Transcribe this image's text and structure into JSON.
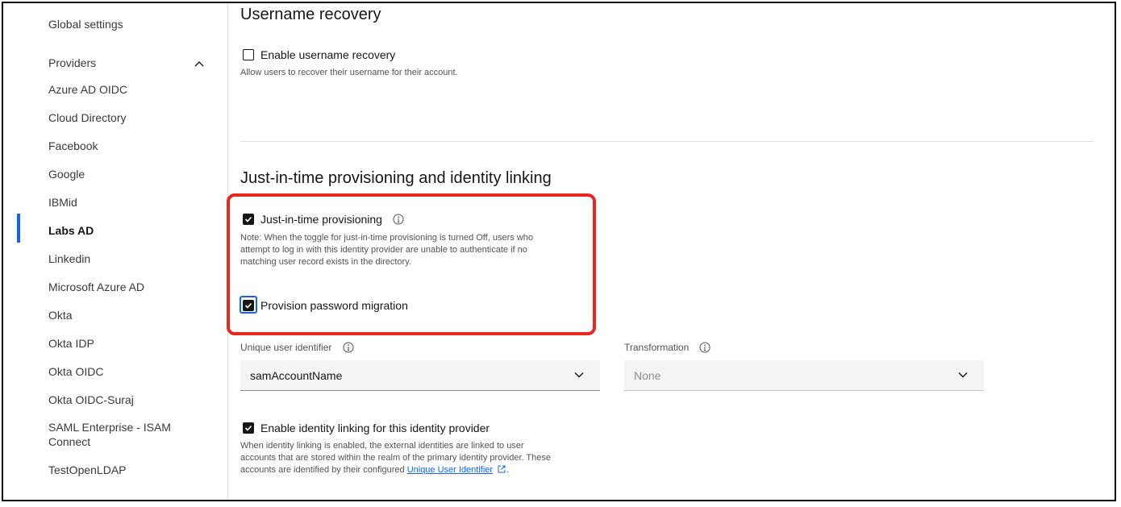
{
  "sidebar": {
    "global_settings": "Global settings",
    "providers_heading": "Providers",
    "items": [
      {
        "label": "Azure AD OIDC"
      },
      {
        "label": "Cloud Directory"
      },
      {
        "label": "Facebook"
      },
      {
        "label": "Google"
      },
      {
        "label": "IBMid"
      },
      {
        "label": "Labs AD"
      },
      {
        "label": "Linkedin"
      },
      {
        "label": "Microsoft Azure AD"
      },
      {
        "label": "Okta"
      },
      {
        "label": "Okta IDP"
      },
      {
        "label": "Okta OIDC"
      },
      {
        "label": "Okta OIDC-Suraj"
      },
      {
        "label": "SAML Enterprise - ISAM Connect"
      },
      {
        "label": "TestOpenLDAP"
      }
    ],
    "active_item": "Labs AD"
  },
  "username_recovery": {
    "title": "Username recovery",
    "checkbox_label": "Enable username recovery",
    "checked": false,
    "helper": "Allow users to recover their username for their account."
  },
  "jit": {
    "title": "Just-in-time provisioning and identity linking",
    "jit_label": "Just-in-time provisioning",
    "jit_checked": true,
    "jit_note_line1": "Note: When the toggle for just-in-time provisioning is turned Off, users who",
    "jit_note_line2": "attempt to log in with this identity provider are unable to authenticate if no",
    "jit_note_line3": "matching user record exists in the directory.",
    "password_migration_label": "Provision password migration",
    "password_migration_checked": true
  },
  "fields": {
    "unique_user_identifier_label": "Unique user identifier",
    "unique_user_identifier_value": "samAccountName",
    "transformation_label": "Transformation",
    "transformation_value": "None"
  },
  "identity_linking": {
    "label": "Enable identity linking for this identity provider",
    "checked": true,
    "helper_line1": "When identity linking is enabled, the external identities are linked to user",
    "helper_line2": "accounts that are stored within the realm of the primary identity provider. These",
    "helper_line3_prefix": "accounts are identified by their configured",
    "helper_link": "Unique User Identifier",
    "helper_suffix": "."
  },
  "colors": {
    "accent": "#0f62fe",
    "highlight": "#e8281f"
  }
}
